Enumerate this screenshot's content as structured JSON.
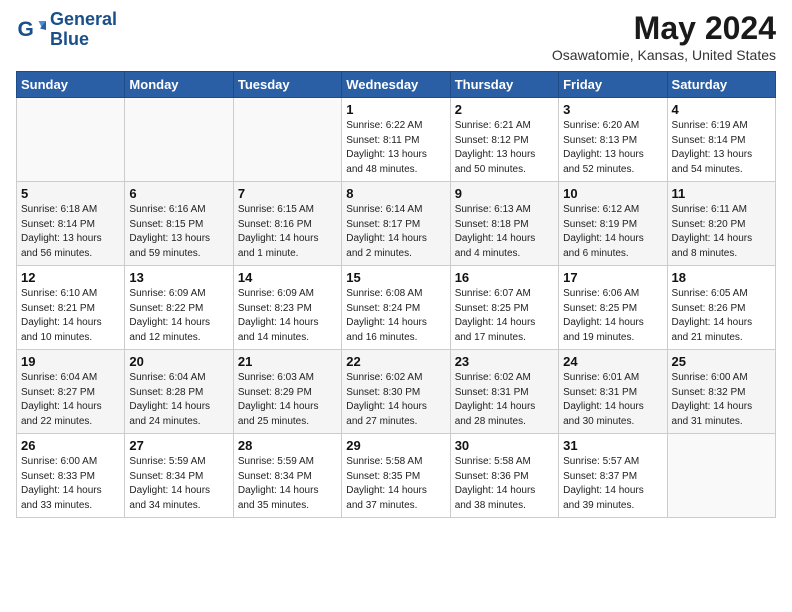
{
  "logo": {
    "line1": "General",
    "line2": "Blue"
  },
  "title": "May 2024",
  "subtitle": "Osawatomie, Kansas, United States",
  "days_of_week": [
    "Sunday",
    "Monday",
    "Tuesday",
    "Wednesday",
    "Thursday",
    "Friday",
    "Saturday"
  ],
  "weeks": [
    [
      {
        "day": "",
        "info": ""
      },
      {
        "day": "",
        "info": ""
      },
      {
        "day": "",
        "info": ""
      },
      {
        "day": "1",
        "info": "Sunrise: 6:22 AM\nSunset: 8:11 PM\nDaylight: 13 hours\nand 48 minutes."
      },
      {
        "day": "2",
        "info": "Sunrise: 6:21 AM\nSunset: 8:12 PM\nDaylight: 13 hours\nand 50 minutes."
      },
      {
        "day": "3",
        "info": "Sunrise: 6:20 AM\nSunset: 8:13 PM\nDaylight: 13 hours\nand 52 minutes."
      },
      {
        "day": "4",
        "info": "Sunrise: 6:19 AM\nSunset: 8:14 PM\nDaylight: 13 hours\nand 54 minutes."
      }
    ],
    [
      {
        "day": "5",
        "info": "Sunrise: 6:18 AM\nSunset: 8:14 PM\nDaylight: 13 hours\nand 56 minutes."
      },
      {
        "day": "6",
        "info": "Sunrise: 6:16 AM\nSunset: 8:15 PM\nDaylight: 13 hours\nand 59 minutes."
      },
      {
        "day": "7",
        "info": "Sunrise: 6:15 AM\nSunset: 8:16 PM\nDaylight: 14 hours\nand 1 minute."
      },
      {
        "day": "8",
        "info": "Sunrise: 6:14 AM\nSunset: 8:17 PM\nDaylight: 14 hours\nand 2 minutes."
      },
      {
        "day": "9",
        "info": "Sunrise: 6:13 AM\nSunset: 8:18 PM\nDaylight: 14 hours\nand 4 minutes."
      },
      {
        "day": "10",
        "info": "Sunrise: 6:12 AM\nSunset: 8:19 PM\nDaylight: 14 hours\nand 6 minutes."
      },
      {
        "day": "11",
        "info": "Sunrise: 6:11 AM\nSunset: 8:20 PM\nDaylight: 14 hours\nand 8 minutes."
      }
    ],
    [
      {
        "day": "12",
        "info": "Sunrise: 6:10 AM\nSunset: 8:21 PM\nDaylight: 14 hours\nand 10 minutes."
      },
      {
        "day": "13",
        "info": "Sunrise: 6:09 AM\nSunset: 8:22 PM\nDaylight: 14 hours\nand 12 minutes."
      },
      {
        "day": "14",
        "info": "Sunrise: 6:09 AM\nSunset: 8:23 PM\nDaylight: 14 hours\nand 14 minutes."
      },
      {
        "day": "15",
        "info": "Sunrise: 6:08 AM\nSunset: 8:24 PM\nDaylight: 14 hours\nand 16 minutes."
      },
      {
        "day": "16",
        "info": "Sunrise: 6:07 AM\nSunset: 8:25 PM\nDaylight: 14 hours\nand 17 minutes."
      },
      {
        "day": "17",
        "info": "Sunrise: 6:06 AM\nSunset: 8:25 PM\nDaylight: 14 hours\nand 19 minutes."
      },
      {
        "day": "18",
        "info": "Sunrise: 6:05 AM\nSunset: 8:26 PM\nDaylight: 14 hours\nand 21 minutes."
      }
    ],
    [
      {
        "day": "19",
        "info": "Sunrise: 6:04 AM\nSunset: 8:27 PM\nDaylight: 14 hours\nand 22 minutes."
      },
      {
        "day": "20",
        "info": "Sunrise: 6:04 AM\nSunset: 8:28 PM\nDaylight: 14 hours\nand 24 minutes."
      },
      {
        "day": "21",
        "info": "Sunrise: 6:03 AM\nSunset: 8:29 PM\nDaylight: 14 hours\nand 25 minutes."
      },
      {
        "day": "22",
        "info": "Sunrise: 6:02 AM\nSunset: 8:30 PM\nDaylight: 14 hours\nand 27 minutes."
      },
      {
        "day": "23",
        "info": "Sunrise: 6:02 AM\nSunset: 8:31 PM\nDaylight: 14 hours\nand 28 minutes."
      },
      {
        "day": "24",
        "info": "Sunrise: 6:01 AM\nSunset: 8:31 PM\nDaylight: 14 hours\nand 30 minutes."
      },
      {
        "day": "25",
        "info": "Sunrise: 6:00 AM\nSunset: 8:32 PM\nDaylight: 14 hours\nand 31 minutes."
      }
    ],
    [
      {
        "day": "26",
        "info": "Sunrise: 6:00 AM\nSunset: 8:33 PM\nDaylight: 14 hours\nand 33 minutes."
      },
      {
        "day": "27",
        "info": "Sunrise: 5:59 AM\nSunset: 8:34 PM\nDaylight: 14 hours\nand 34 minutes."
      },
      {
        "day": "28",
        "info": "Sunrise: 5:59 AM\nSunset: 8:34 PM\nDaylight: 14 hours\nand 35 minutes."
      },
      {
        "day": "29",
        "info": "Sunrise: 5:58 AM\nSunset: 8:35 PM\nDaylight: 14 hours\nand 37 minutes."
      },
      {
        "day": "30",
        "info": "Sunrise: 5:58 AM\nSunset: 8:36 PM\nDaylight: 14 hours\nand 38 minutes."
      },
      {
        "day": "31",
        "info": "Sunrise: 5:57 AM\nSunset: 8:37 PM\nDaylight: 14 hours\nand 39 minutes."
      },
      {
        "day": "",
        "info": ""
      }
    ]
  ]
}
